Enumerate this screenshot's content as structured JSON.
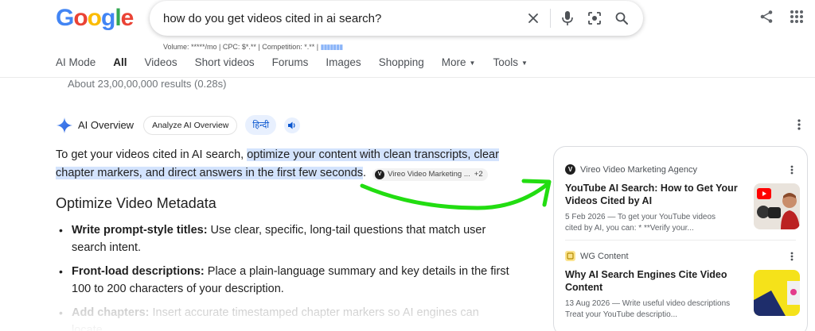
{
  "header": {
    "logo_letters": [
      {
        "ch": "G",
        "color": "#4285F4"
      },
      {
        "ch": "o",
        "color": "#EA4335"
      },
      {
        "ch": "o",
        "color": "#FBBC05"
      },
      {
        "ch": "g",
        "color": "#4285F4"
      },
      {
        "ch": "l",
        "color": "#34A853"
      },
      {
        "ch": "e",
        "color": "#EA4335"
      }
    ],
    "query": "how do you get videos cited in ai search?",
    "seo_line": "Volume: *****/mo | CPC: $*.** | Competition: *.** |",
    "icons": [
      "clear-icon",
      "mic-icon",
      "lens-icon",
      "search-icon",
      "share-icon",
      "apps-grid-icon"
    ]
  },
  "tabs": [
    {
      "label": "AI Mode",
      "active": false
    },
    {
      "label": "All",
      "active": true
    },
    {
      "label": "Videos",
      "active": false
    },
    {
      "label": "Short videos",
      "active": false
    },
    {
      "label": "Forums",
      "active": false
    },
    {
      "label": "Images",
      "active": false
    },
    {
      "label": "Shopping",
      "active": false
    },
    {
      "label": "More",
      "active": false,
      "caret": true
    },
    {
      "label": "Tools",
      "active": false,
      "caret": true
    }
  ],
  "results_count": "About 23,00,00,000 results (0.28s)",
  "ai_overview": {
    "title": "AI Overview",
    "analyze_label": "Analyze AI Overview",
    "hindi_label": "हिन्दी",
    "lead_plain": "To get your videos cited in AI search, ",
    "lead_highlight": "optimize your content with clean transcripts, clear chapter markers, and direct answers in the first few seconds",
    "lead_end": ".",
    "cite_chip": {
      "badge": "V",
      "label": "Vireo Video Marketing ...",
      "more": "+2"
    },
    "heading": "Optimize Video Metadata",
    "bullets": [
      {
        "bold": "Write prompt-style titles:",
        "text": " Use clear, specific, long-tail questions that match user search intent."
      },
      {
        "bold": "Front-load descriptions:",
        "text": " Place a plain-language summary and key details in the first 100 to 200 characters of your description."
      },
      {
        "bold": "Add chapters:",
        "text": " Insert accurate timestamped chapter markers so AI engines can locate"
      }
    ]
  },
  "sources": [
    {
      "site": "Vireo Video Marketing Agency",
      "badge": "V",
      "title": "YouTube AI Search: How to Get Your Videos Cited by AI",
      "snippet": "5 Feb 2026 — To get your YouTube videos cited by AI, you can: * **Verify your..."
    },
    {
      "site": "WG Content",
      "badge": "",
      "title": "Why AI Search Engines Cite Video Content",
      "snippet": "13 Aug 2026 — Write useful video descriptions Treat your YouTube descriptio..."
    }
  ],
  "colors": {
    "highlight": "#d3e3fd",
    "arrow": "#22dd11",
    "link_blue": "#0b57d0"
  }
}
